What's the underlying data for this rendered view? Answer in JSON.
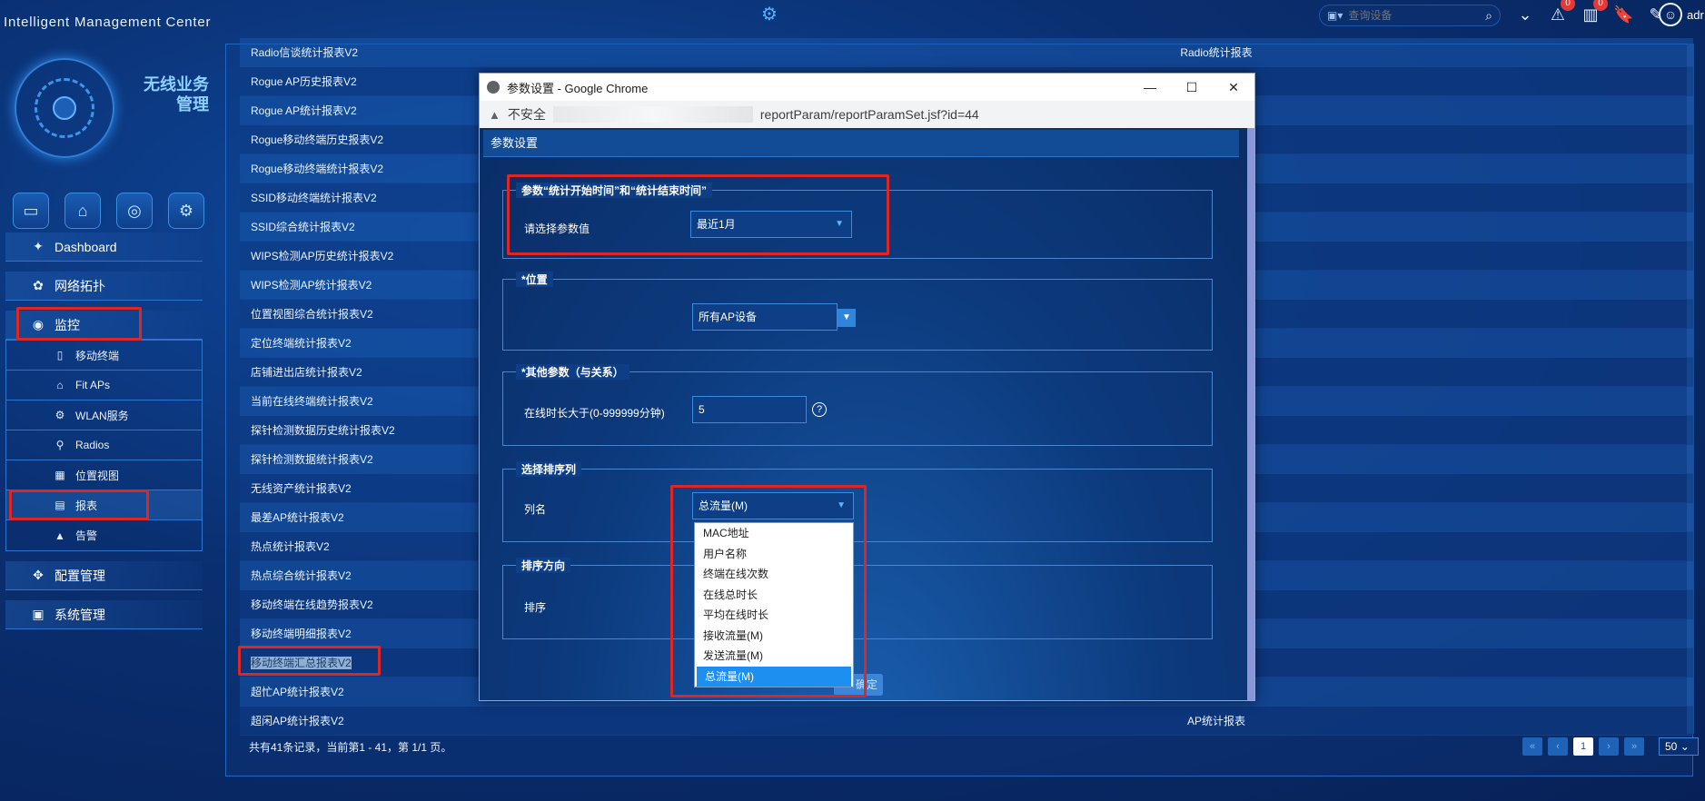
{
  "app": {
    "title": "Intelligent Management Center"
  },
  "topbar": {
    "search_placeholder": "查询设备",
    "alarm_badge": "0",
    "report_badge": "0",
    "user_name": "adr"
  },
  "sidebar": {
    "logo_title": "无线业务\n管理",
    "menu": [
      {
        "label": "Dashboard",
        "icon": "antenna-icon"
      },
      {
        "label": "网络拓扑",
        "icon": "topology-icon"
      },
      {
        "label": "监控",
        "icon": "eye-icon"
      }
    ],
    "submenu": [
      {
        "label": "移动终端",
        "icon": "mobile-icon"
      },
      {
        "label": "Fit APs",
        "icon": "ap-icon"
      },
      {
        "label": "WLAN服务",
        "icon": "wlan-icon"
      },
      {
        "label": "Radios",
        "icon": "radio-icon"
      },
      {
        "label": "位置视图",
        "icon": "location-icon"
      },
      {
        "label": "报表",
        "icon": "report-icon"
      },
      {
        "label": "告警",
        "icon": "alarm-icon"
      }
    ],
    "menu_bottom": [
      {
        "label": "配置管理",
        "icon": "config-icon"
      },
      {
        "label": "系统管理",
        "icon": "system-icon"
      }
    ]
  },
  "reports": {
    "rows": [
      {
        "name": "Radio信谈统计报表V2",
        "type": "Radio统计报表"
      },
      {
        "name": "Rogue AP历史报表V2",
        "type": ""
      },
      {
        "name": "Rogue AP统计报表V2",
        "type": ""
      },
      {
        "name": "Rogue移动终端历史报表V2",
        "type": ""
      },
      {
        "name": "Rogue移动终端统计报表V2",
        "type": ""
      },
      {
        "name": "SSID移动终端统计报表V2",
        "type": ""
      },
      {
        "name": "SSID综合统计报表V2",
        "type": ""
      },
      {
        "name": "WIPS检测AP历史统计报表V2",
        "type": ""
      },
      {
        "name": "WIPS检测AP统计报表V2",
        "type": ""
      },
      {
        "name": "位置视图综合统计报表V2",
        "type": ""
      },
      {
        "name": "定位终端统计报表V2",
        "type": ""
      },
      {
        "name": "店铺进出店统计报表V2",
        "type": ""
      },
      {
        "name": "当前在线终端统计报表V2",
        "type": ""
      },
      {
        "name": "探针检测数据历史统计报表V2",
        "type": ""
      },
      {
        "name": "探针检测数据统计报表V2",
        "type": ""
      },
      {
        "name": "无线资产统计报表V2",
        "type": ""
      },
      {
        "name": "最差AP统计报表V2",
        "type": ""
      },
      {
        "name": "热点统计报表V2",
        "type": ""
      },
      {
        "name": "热点综合统计报表V2",
        "type": ""
      },
      {
        "name": "移动终端在线趋势报表V2",
        "type": ""
      },
      {
        "name": "移动终端明细报表V2",
        "type": ""
      },
      {
        "name": "移动终端汇总报表V2",
        "type": ""
      },
      {
        "name": "超忙AP统计报表V2",
        "type": ""
      },
      {
        "name": "超闲AP统计报表V2",
        "type": "AP统计报表"
      }
    ],
    "footer": "共有41条记录，当前第1 - 41，第 1/1 页。",
    "pager": {
      "current": "1",
      "page_size": "50"
    }
  },
  "popup": {
    "window_title": "参数设置 - Google Chrome",
    "url_insecure": "不安全",
    "url_path": "reportParam/reportParamSet.jsf?id=44",
    "dialog_title": "参数设置",
    "time_section": {
      "legend": "参数“统计开始时间”和“统计结束时间”",
      "label": "请选择参数值",
      "value": "最近1月"
    },
    "location_section": {
      "legend": "*位置",
      "value": "所有AP设备"
    },
    "other_section": {
      "legend": "*其他参数（与关系）",
      "label": "在线时长大于(0-999999分钟)",
      "value": "5",
      "help": "?"
    },
    "sort_column_section": {
      "legend": "选择排序列",
      "label": "列名",
      "value": "总流量(M)",
      "options": [
        "MAC地址",
        "用户名称",
        "终端在线次数",
        "在线总时长",
        "平均在线时长",
        "接收流量(M)",
        "发送流量(M)",
        "总流量(M)"
      ]
    },
    "sort_direction_section": {
      "legend": "排序方向",
      "label": "排序"
    },
    "confirm_label": "确定"
  }
}
